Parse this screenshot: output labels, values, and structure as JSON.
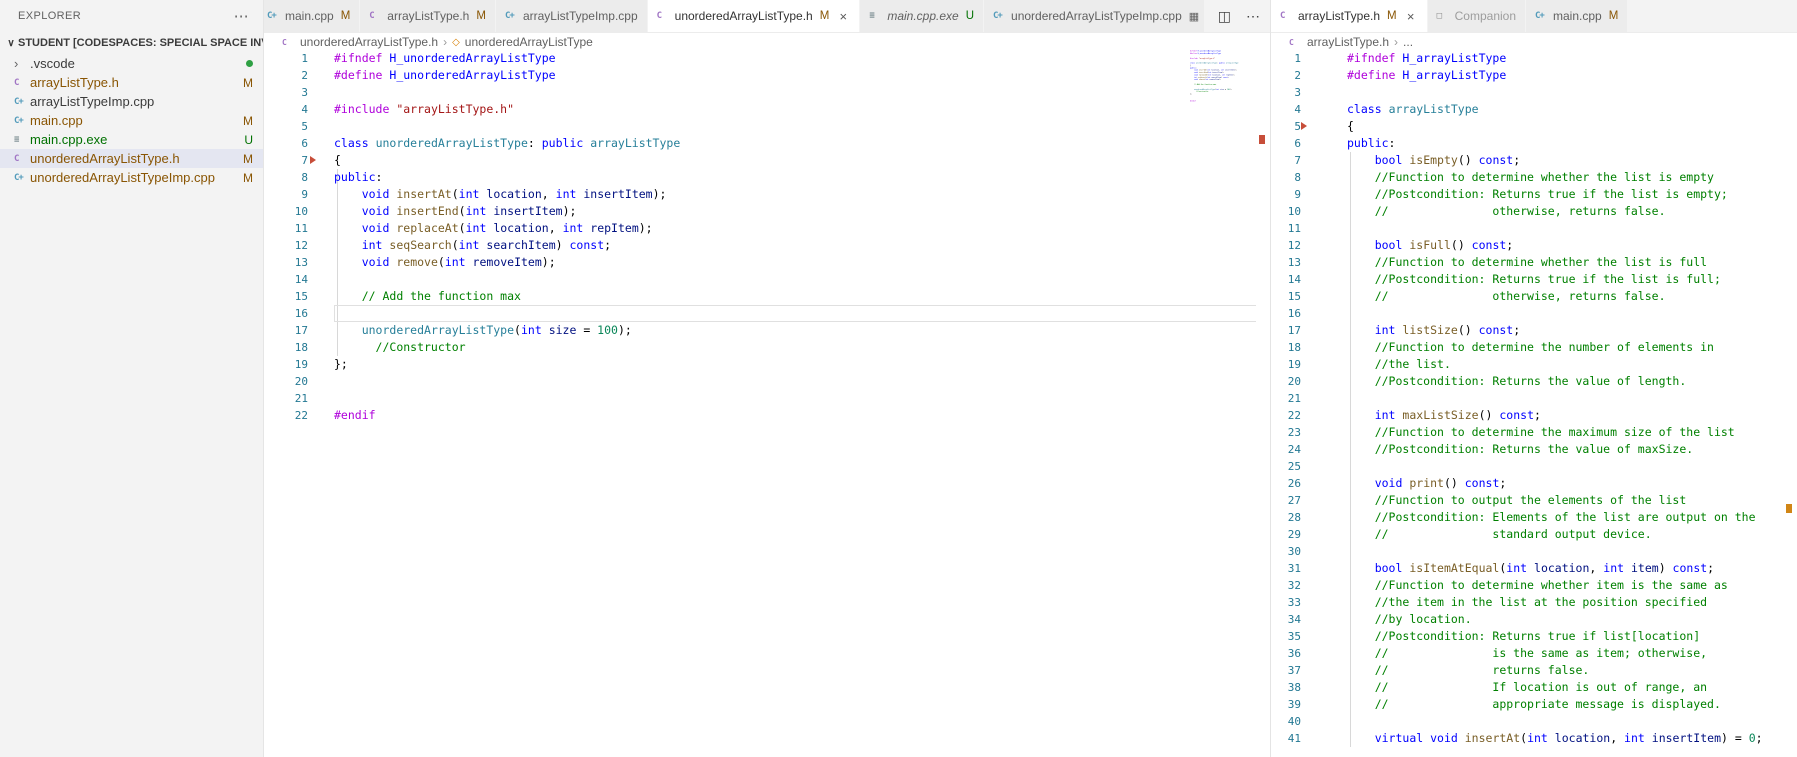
{
  "colors": {
    "ruler_mark_left": "#c74e39",
    "ruler_mark_right": "#d18616"
  },
  "file_icons": {
    "cpp": {
      "glyph": "C+",
      "color": "#519aba"
    },
    "h": {
      "glyph": "C",
      "color": "#a074c4"
    },
    "exe": {
      "glyph": "≡",
      "color": "#6d8086"
    },
    "generic": {
      "glyph": "□",
      "color": "#8e8e8e"
    }
  },
  "sidebar": {
    "title": "EXPLORER",
    "more_icon": "⋯",
    "section_chevron": "∨",
    "section": "STUDENT [CODESPACES: SPECIAL SPACE INVENTION]",
    "items": [
      {
        "label": ".vscode",
        "kind": "folder",
        "chevron": "›",
        "badge": "",
        "status": "none",
        "dot": true
      },
      {
        "label": "arrayListType.h",
        "kind": "h",
        "badge": "M",
        "status": "modified"
      },
      {
        "label": "arrayListTypeImp.cpp",
        "kind": "cpp",
        "badge": "",
        "status": "none"
      },
      {
        "label": "main.cpp",
        "kind": "cpp",
        "badge": "M",
        "status": "modified"
      },
      {
        "label": "main.cpp.exe",
        "kind": "exe",
        "badge": "U",
        "status": "untracked"
      },
      {
        "label": "unorderedArrayListType.h",
        "kind": "h",
        "badge": "M",
        "status": "modified",
        "selected": true
      },
      {
        "label": "unorderedArrayListTypeImp.cpp",
        "kind": "cpp",
        "badge": "M",
        "status": "modified"
      }
    ]
  },
  "groups": [
    {
      "tabs": [
        {
          "label": "main.cpp",
          "icon": "cpp",
          "badge": "M",
          "status": "modified",
          "clipped": true
        },
        {
          "label": "arrayListType.h",
          "icon": "h",
          "badge": "M",
          "status": "modified"
        },
        {
          "label": "arrayListTypeImp.cpp",
          "icon": "cpp",
          "badge": "",
          "status": "none"
        },
        {
          "label": "unorderedArrayListType.h",
          "icon": "h",
          "badge": "M",
          "status": "modified",
          "active": true,
          "close": "×"
        },
        {
          "label": "main.cpp.exe",
          "icon": "exe",
          "badge": "U",
          "status": "untracked",
          "italic": true
        },
        {
          "label": "unorderedArrayListTypeImp.cpp",
          "icon": "cpp",
          "badge": "",
          "status": "none",
          "trailing_icon": "▦"
        }
      ],
      "toolbar": {
        "split_icon": "◫",
        "more_icon": "⋯"
      },
      "breadcrumb": {
        "file": "unorderedArrayListType.h",
        "separator": "›",
        "symbol_icon": "◇",
        "symbol": "unorderedArrayListType"
      }
    },
    {
      "tabs": [
        {
          "label": "arrayListType.h",
          "icon": "h",
          "badge": "M",
          "status": "modified",
          "active": true,
          "close": "×"
        },
        {
          "label": "Companion",
          "icon": "generic",
          "badge": "",
          "status": "none",
          "dim": true
        },
        {
          "label": "main.cpp",
          "icon": "cpp",
          "badge": "M",
          "status": "modified"
        }
      ],
      "breadcrumb": {
        "file": "arrayListType.h",
        "separator": "›",
        "symbol": "..."
      }
    }
  ],
  "editors": {
    "left": {
      "current_line": 16,
      "lines": [
        [
          [
            "p",
            "#ifndef"
          ],
          [
            "x",
            " "
          ],
          [
            "m",
            "H_unorderedArrayListType"
          ]
        ],
        [
          [
            "p",
            "#define"
          ],
          [
            "x",
            " "
          ],
          [
            "m",
            "H_unorderedArrayListType"
          ]
        ],
        [],
        [
          [
            "p",
            "#include"
          ],
          [
            "x",
            " "
          ],
          [
            "s",
            "\"arrayListType.h\""
          ]
        ],
        [],
        [
          [
            "k",
            "class"
          ],
          [
            "x",
            " "
          ],
          [
            "t",
            "unorderedArrayListType"
          ],
          [
            "x",
            ": "
          ],
          [
            "k",
            "public"
          ],
          [
            "x",
            " "
          ],
          [
            "t",
            "arrayListType"
          ]
        ],
        [
          [
            "x",
            "{"
          ]
        ],
        [
          [
            "k",
            "public"
          ],
          [
            "x",
            ":"
          ]
        ],
        [
          [
            "x",
            "    "
          ],
          [
            "k",
            "void"
          ],
          [
            "x",
            " "
          ],
          [
            "f",
            "insertAt"
          ],
          [
            "x",
            "("
          ],
          [
            "k",
            "int"
          ],
          [
            "x",
            " "
          ],
          [
            "v",
            "location"
          ],
          [
            "x",
            ", "
          ],
          [
            "k",
            "int"
          ],
          [
            "x",
            " "
          ],
          [
            "v",
            "insertItem"
          ],
          [
            "x",
            ");"
          ]
        ],
        [
          [
            "x",
            "    "
          ],
          [
            "k",
            "void"
          ],
          [
            "x",
            " "
          ],
          [
            "f",
            "insertEnd"
          ],
          [
            "x",
            "("
          ],
          [
            "k",
            "int"
          ],
          [
            "x",
            " "
          ],
          [
            "v",
            "insertItem"
          ],
          [
            "x",
            ");"
          ]
        ],
        [
          [
            "x",
            "    "
          ],
          [
            "k",
            "void"
          ],
          [
            "x",
            " "
          ],
          [
            "f",
            "replaceAt"
          ],
          [
            "x",
            "("
          ],
          [
            "k",
            "int"
          ],
          [
            "x",
            " "
          ],
          [
            "v",
            "location"
          ],
          [
            "x",
            ", "
          ],
          [
            "k",
            "int"
          ],
          [
            "x",
            " "
          ],
          [
            "v",
            "repItem"
          ],
          [
            "x",
            ");"
          ]
        ],
        [
          [
            "x",
            "    "
          ],
          [
            "k",
            "int"
          ],
          [
            "x",
            " "
          ],
          [
            "f",
            "seqSearch"
          ],
          [
            "x",
            "("
          ],
          [
            "k",
            "int"
          ],
          [
            "x",
            " "
          ],
          [
            "v",
            "searchItem"
          ],
          [
            "x",
            ") "
          ],
          [
            "k",
            "const"
          ],
          [
            "x",
            ";"
          ]
        ],
        [
          [
            "x",
            "    "
          ],
          [
            "k",
            "void"
          ],
          [
            "x",
            " "
          ],
          [
            "f",
            "remove"
          ],
          [
            "x",
            "("
          ],
          [
            "k",
            "int"
          ],
          [
            "x",
            " "
          ],
          [
            "v",
            "removeItem"
          ],
          [
            "x",
            ");"
          ]
        ],
        [],
        [
          [
            "x",
            "    "
          ],
          [
            "c",
            "// Add the function max"
          ]
        ],
        [],
        [
          [
            "x",
            "    "
          ],
          [
            "t",
            "unorderedArrayListType"
          ],
          [
            "x",
            "("
          ],
          [
            "k",
            "int"
          ],
          [
            "x",
            " "
          ],
          [
            "v",
            "size"
          ],
          [
            "x",
            " = "
          ],
          [
            "n",
            "100"
          ],
          [
            "x",
            ");"
          ]
        ],
        [
          [
            "x",
            "      "
          ],
          [
            "c",
            "//Constructor"
          ]
        ],
        [
          [
            "x",
            "};"
          ]
        ],
        [],
        [],
        [
          [
            "p",
            "#endif"
          ]
        ]
      ]
    },
    "right": {
      "lines": [
        [
          [
            "p",
            "#ifndef"
          ],
          [
            "x",
            " "
          ],
          [
            "m",
            "H_arrayListType"
          ]
        ],
        [
          [
            "p",
            "#define"
          ],
          [
            "x",
            " "
          ],
          [
            "m",
            "H_arrayListType"
          ]
        ],
        [],
        [
          [
            "k",
            "class"
          ],
          [
            "x",
            " "
          ],
          [
            "t",
            "arrayListType"
          ]
        ],
        [
          [
            "x",
            "{"
          ]
        ],
        [
          [
            "k",
            "public"
          ],
          [
            "x",
            ":"
          ]
        ],
        [
          [
            "x",
            "    "
          ],
          [
            "k",
            "bool"
          ],
          [
            "x",
            " "
          ],
          [
            "f",
            "isEmpty"
          ],
          [
            "x",
            "() "
          ],
          [
            "k",
            "const"
          ],
          [
            "x",
            ";"
          ]
        ],
        [
          [
            "x",
            "    "
          ],
          [
            "c",
            "//Function to determine whether the list is empty"
          ]
        ],
        [
          [
            "x",
            "    "
          ],
          [
            "c",
            "//Postcondition: Returns true if the list is empty;"
          ]
        ],
        [
          [
            "x",
            "    "
          ],
          [
            "c",
            "//               otherwise, returns false."
          ]
        ],
        [],
        [
          [
            "x",
            "    "
          ],
          [
            "k",
            "bool"
          ],
          [
            "x",
            " "
          ],
          [
            "f",
            "isFull"
          ],
          [
            "x",
            "() "
          ],
          [
            "k",
            "const"
          ],
          [
            "x",
            ";"
          ]
        ],
        [
          [
            "x",
            "    "
          ],
          [
            "c",
            "//Function to determine whether the list is full"
          ]
        ],
        [
          [
            "x",
            "    "
          ],
          [
            "c",
            "//Postcondition: Returns true if the list is full;"
          ]
        ],
        [
          [
            "x",
            "    "
          ],
          [
            "c",
            "//               otherwise, returns false."
          ]
        ],
        [],
        [
          [
            "x",
            "    "
          ],
          [
            "k",
            "int"
          ],
          [
            "x",
            " "
          ],
          [
            "f",
            "listSize"
          ],
          [
            "x",
            "() "
          ],
          [
            "k",
            "const"
          ],
          [
            "x",
            ";"
          ]
        ],
        [
          [
            "x",
            "    "
          ],
          [
            "c",
            "//Function to determine the number of elements in"
          ]
        ],
        [
          [
            "x",
            "    "
          ],
          [
            "c",
            "//the list."
          ]
        ],
        [
          [
            "x",
            "    "
          ],
          [
            "c",
            "//Postcondition: Returns the value of length."
          ]
        ],
        [],
        [
          [
            "x",
            "    "
          ],
          [
            "k",
            "int"
          ],
          [
            "x",
            " "
          ],
          [
            "f",
            "maxListSize"
          ],
          [
            "x",
            "() "
          ],
          [
            "k",
            "const"
          ],
          [
            "x",
            ";"
          ]
        ],
        [
          [
            "x",
            "    "
          ],
          [
            "c",
            "//Function to determine the maximum size of the list"
          ]
        ],
        [
          [
            "x",
            "    "
          ],
          [
            "c",
            "//Postcondition: Returns the value of maxSize."
          ]
        ],
        [],
        [
          [
            "x",
            "    "
          ],
          [
            "k",
            "void"
          ],
          [
            "x",
            " "
          ],
          [
            "f",
            "print"
          ],
          [
            "x",
            "() "
          ],
          [
            "k",
            "const"
          ],
          [
            "x",
            ";"
          ]
        ],
        [
          [
            "x",
            "    "
          ],
          [
            "c",
            "//Function to output the elements of the list"
          ]
        ],
        [
          [
            "x",
            "    "
          ],
          [
            "c",
            "//Postcondition: Elements of the list are output on the"
          ]
        ],
        [
          [
            "x",
            "    "
          ],
          [
            "c",
            "//               standard output device."
          ]
        ],
        [],
        [
          [
            "x",
            "    "
          ],
          [
            "k",
            "bool"
          ],
          [
            "x",
            " "
          ],
          [
            "f",
            "isItemAtEqual"
          ],
          [
            "x",
            "("
          ],
          [
            "k",
            "int"
          ],
          [
            "x",
            " "
          ],
          [
            "v",
            "location"
          ],
          [
            "x",
            ", "
          ],
          [
            "k",
            "int"
          ],
          [
            "x",
            " "
          ],
          [
            "v",
            "item"
          ],
          [
            "x",
            ") "
          ],
          [
            "k",
            "const"
          ],
          [
            "x",
            ";"
          ]
        ],
        [
          [
            "x",
            "    "
          ],
          [
            "c",
            "//Function to determine whether item is the same as"
          ]
        ],
        [
          [
            "x",
            "    "
          ],
          [
            "c",
            "//the item in the list at the position specified"
          ]
        ],
        [
          [
            "x",
            "    "
          ],
          [
            "c",
            "//by location."
          ]
        ],
        [
          [
            "x",
            "    "
          ],
          [
            "c",
            "//Postcondition: Returns true if list[location]"
          ]
        ],
        [
          [
            "x",
            "    "
          ],
          [
            "c",
            "//               is the same as item; otherwise,"
          ]
        ],
        [
          [
            "x",
            "    "
          ],
          [
            "c",
            "//               returns false."
          ]
        ],
        [
          [
            "x",
            "    "
          ],
          [
            "c",
            "//               If location is out of range, an"
          ]
        ],
        [
          [
            "x",
            "    "
          ],
          [
            "c",
            "//               appropriate message is displayed."
          ]
        ],
        [],
        [
          [
            "x",
            "    "
          ],
          [
            "k",
            "virtual"
          ],
          [
            "x",
            " "
          ],
          [
            "k",
            "void"
          ],
          [
            "x",
            " "
          ],
          [
            "f",
            "insertAt"
          ],
          [
            "x",
            "("
          ],
          [
            "k",
            "int"
          ],
          [
            "x",
            " "
          ],
          [
            "v",
            "location"
          ],
          [
            "x",
            ", "
          ],
          [
            "k",
            "int"
          ],
          [
            "x",
            " "
          ],
          [
            "v",
            "insertItem"
          ],
          [
            "x",
            ") = "
          ],
          [
            "n",
            "0"
          ],
          [
            "x",
            ";"
          ]
        ]
      ]
    }
  }
}
